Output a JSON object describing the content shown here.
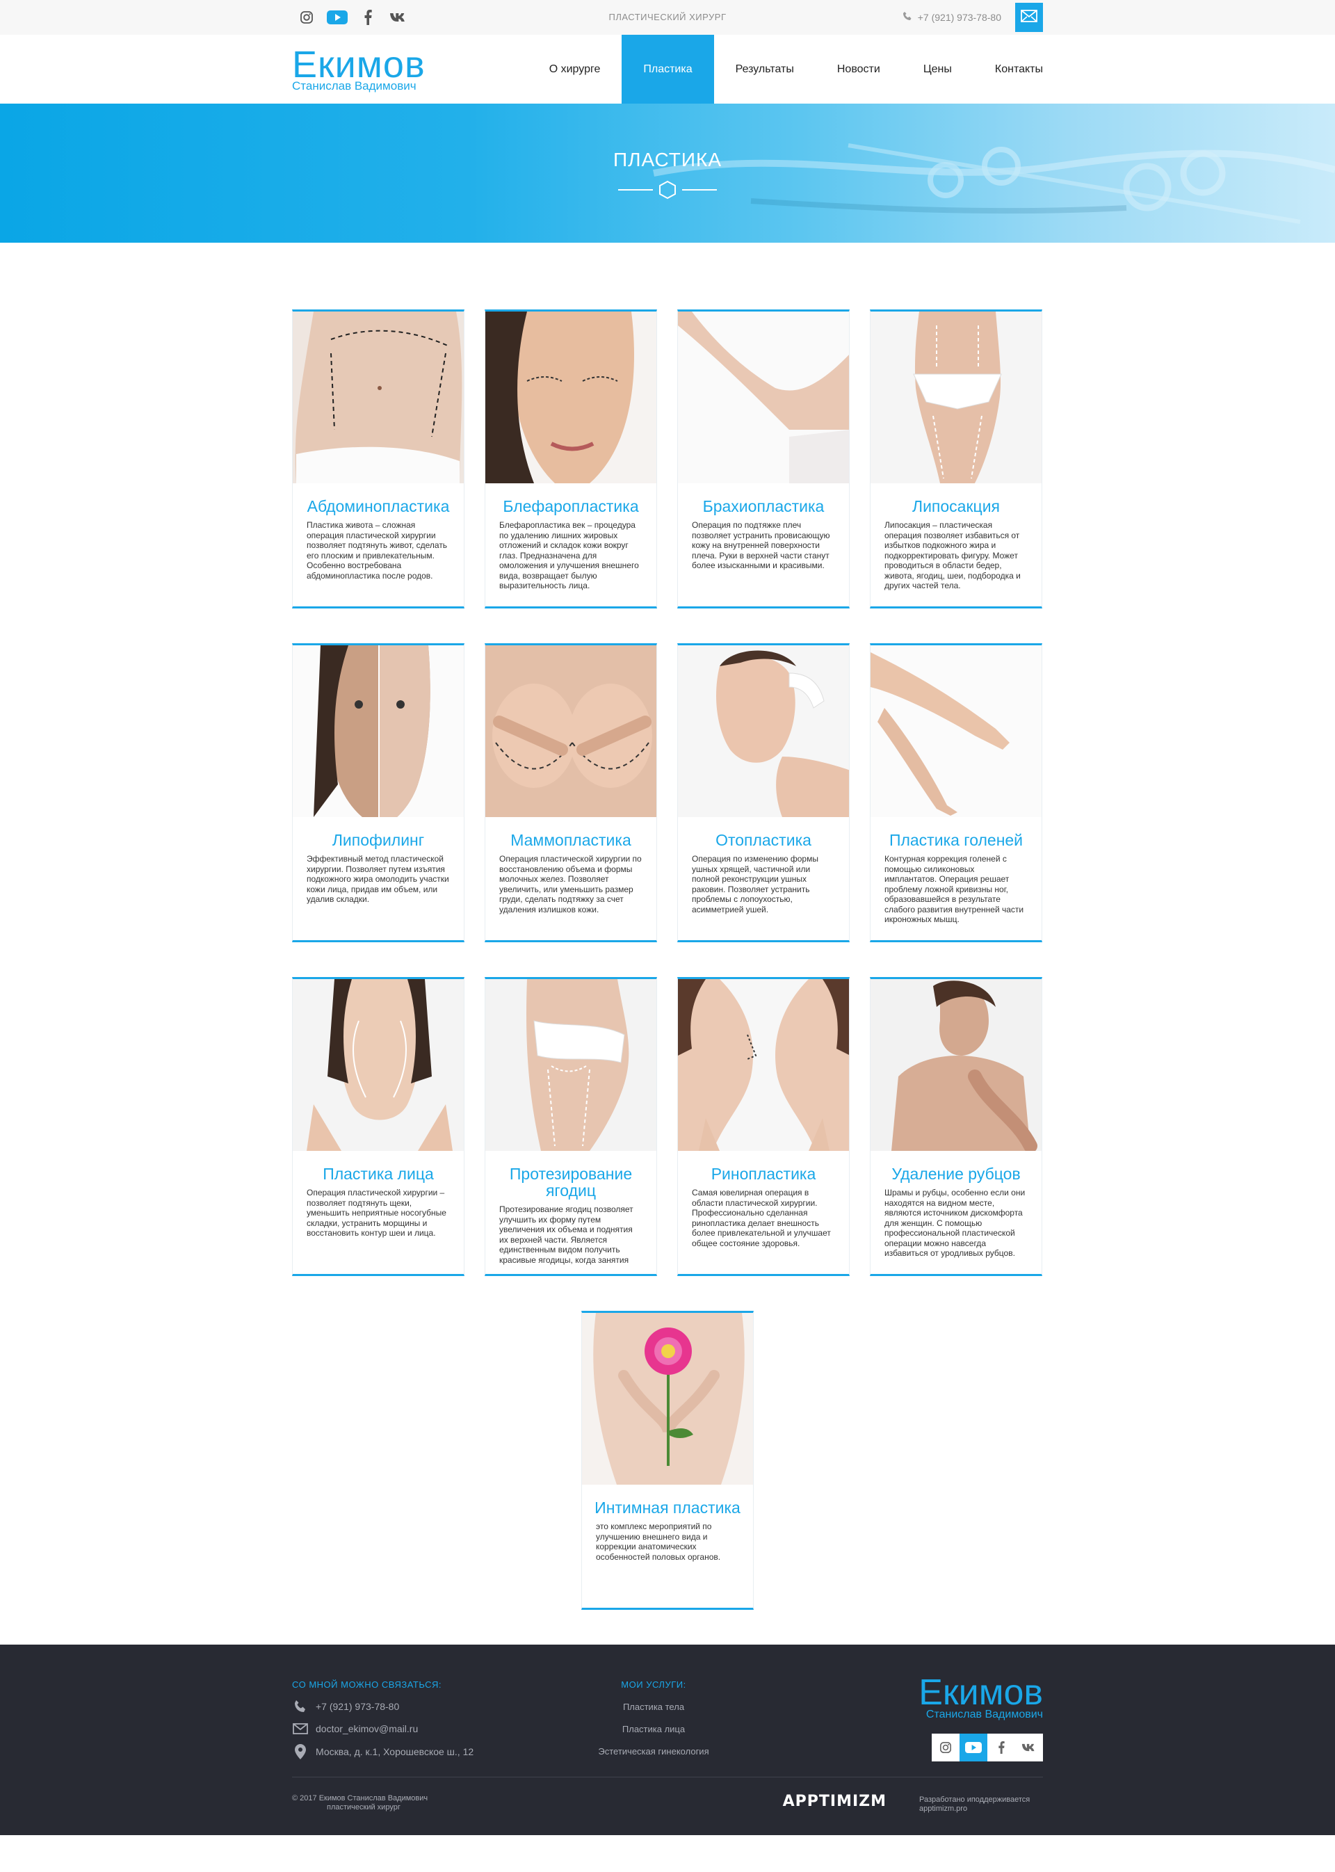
{
  "topbar": {
    "tagline": "ПЛАСТИЧЕСКИЙ ХИРУРГ",
    "phone": "+7 (921) 973-78-80",
    "socials": [
      "instagram-icon",
      "youtube-icon",
      "facebook-icon",
      "vk-icon"
    ]
  },
  "header": {
    "logo_name": "Екимов",
    "logo_sub": "Станислав Вадимович",
    "nav": [
      "О хирурге",
      "Пластика",
      "Результаты",
      "Новости",
      "Цены",
      "Контакты"
    ],
    "active_nav": "Пластика"
  },
  "banner": {
    "title": "ПЛАСТИКА"
  },
  "cards": [
    {
      "title": "Абдоминопластика",
      "text": "Пластика живота – сложная операция пластической хирургии позволяет подтянуть живот, сделать его плоским и привлекательным. Особенно востребована абдоминопластика после родов."
    },
    {
      "title": "Блефаропластика",
      "text": "Блефаропластика век – процедура по удалению лишних жировых отложений и складок кожи вокруг глаз. Предназначена для омоложения и улучшения внешнего вида, возвращает былую выразительность лица."
    },
    {
      "title": "Брахиопластика",
      "text": "Операция по подтяжке плеч позволяет устранить провисающую кожу на внутренней поверхности плеча. Руки в верхней части станут более изысканными и красивыми."
    },
    {
      "title": "Липосакция",
      "text": "Липосакция – пластическая операция позволяет избавиться от избытков подкожного жира и подкорректировать фигуру. Может проводиться в области бедер, живота, ягодиц, шеи, подбородка и других частей тела."
    },
    {
      "title": "Липофилинг",
      "text": "Эффективный метод пластической хирургии. Позволяет путем изъятия подкожного жира омолодить участки кожи лица, придав им объем, или удалив складки."
    },
    {
      "title": "Маммопластика",
      "text": "Операция пластической хирургии по восстановлению объема и формы молочных желез. Позволяет увеличить, или уменьшить размер груди, сделать подтяжку за счет удаления излишков кожи."
    },
    {
      "title": "Отопластика",
      "text": "Операция по изменению формы ушных хрящей, частичной или полной реконструкции ушных раковин. Позволяет устранить проблемы с лопоухостью, асимметрией ушей."
    },
    {
      "title": "Пластика голеней",
      "text": "Контурная коррекция голеней с помощью силиконовых имплантатов. Операция решает проблему ложной кривизны ног, образовавшейся в результате слабого развития внутренней части икроножных мышц."
    },
    {
      "title": "Пластика лица",
      "text": "Операция пластической хирургии – позволяет подтянуть щеки, уменьшить неприятные носогубные складки, устранить морщины и восстановить контур шеи и лица."
    },
    {
      "title": "Протезирование ягодиц",
      "text": "Протезирование ягодиц позволяет улучшить их форму путем увеличения их объема и поднятия их верхней части. Является единственным видом получить красивые ягодицы, когда занятия"
    },
    {
      "title": "Ринопластика",
      "text": "Самая ювелирная операция в области пластической хирургии. Профессионально сделанная ринопластика делает внешность более привлекательной и улучшает общее состояние здоровья."
    },
    {
      "title": "Удаление рубцов",
      "text": "Шрамы и рубцы, особенно если они находятся на видном месте, являются источником дискомфорта для женщин. С помощью профессиональной пластической операции можно навсегда избавиться от уродливых рубцов."
    },
    {
      "title": "Интимная пластика",
      "text": "это комплекс мероприятий по улучшению внешнего вида и коррекции анатомических особенностей половых органов."
    }
  ],
  "footer": {
    "contact_heading": "СО МНОЙ МОЖНО СВЯЗАТЬСЯ:",
    "phone": "+7 (921) 973-78-80",
    "email": "doctor_ekimov@mail.ru",
    "address": "Москва, д. к.1, Хорошевское ш., 12",
    "services_heading": "МОИ УСЛУГИ:",
    "services": [
      "Пластика тела",
      "Пластика лица",
      "Эстетическая гинекология"
    ],
    "logo_name": "Екимов",
    "logo_sub": "Станислав Вадимович",
    "copyright_1": "© 2017 Екимов Станислав Вадимович",
    "copyright_2": "пластический хирург",
    "dev_brand": "APPTIMIZM",
    "dev_text_1": "Разработано иподдерживается",
    "dev_text_2": "apptimizm.pro"
  },
  "colors": {
    "accent": "#1aa7e8",
    "footer_bg": "#282a33"
  }
}
